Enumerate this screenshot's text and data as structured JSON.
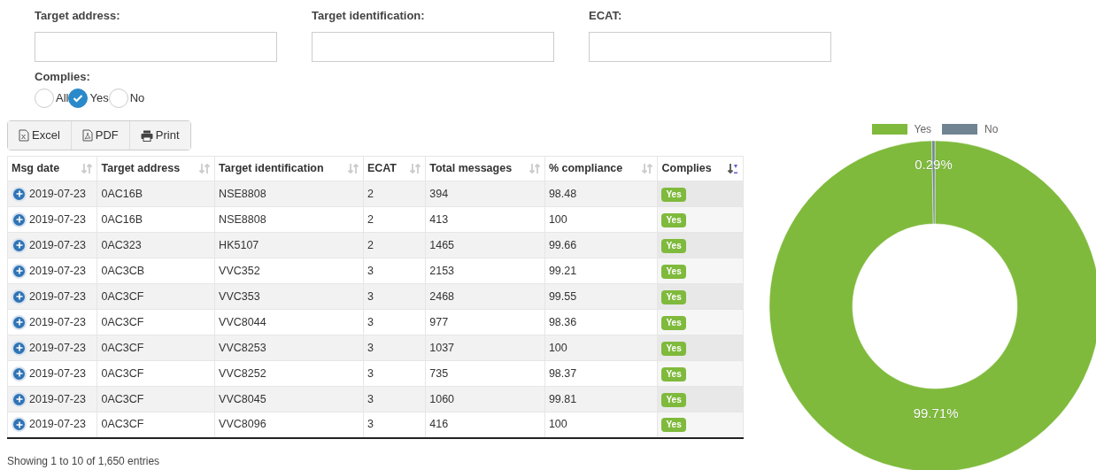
{
  "filters": [
    {
      "label": "Target address:"
    },
    {
      "label": "Target identification:"
    },
    {
      "label": "ECAT:"
    }
  ],
  "complies_filter": {
    "label": "Complies:",
    "options": [
      {
        "label": "All",
        "selected": false
      },
      {
        "label": "Yes",
        "selected": true
      },
      {
        "label": "No",
        "selected": false
      }
    ]
  },
  "export_buttons": [
    {
      "label": "Excel",
      "kind": "excel"
    },
    {
      "label": "PDF",
      "kind": "pdf"
    },
    {
      "label": "Print",
      "kind": "print"
    }
  ],
  "table": {
    "columns": [
      {
        "label": "Msg date",
        "sorted": false
      },
      {
        "label": "Target address",
        "sorted": false
      },
      {
        "label": "Target identification",
        "sorted": false
      },
      {
        "label": "ECAT",
        "sorted": false
      },
      {
        "label": "Total messages",
        "sorted": false
      },
      {
        "label": "% compliance",
        "sorted": false
      },
      {
        "label": "Complies",
        "sorted": true
      }
    ],
    "rows": [
      [
        "2019-07-23",
        "0AC16B",
        "NSE8808",
        "2",
        "394",
        "98.48",
        "Yes"
      ],
      [
        "2019-07-23",
        "0AC16B",
        "NSE8808",
        "2",
        "413",
        "100",
        "Yes"
      ],
      [
        "2019-07-23",
        "0AC323",
        "HK5107",
        "2",
        "1465",
        "99.66",
        "Yes"
      ],
      [
        "2019-07-23",
        "0AC3CB",
        "VVC352",
        "3",
        "2153",
        "99.21",
        "Yes"
      ],
      [
        "2019-07-23",
        "0AC3CF",
        "VVC353",
        "3",
        "2468",
        "99.55",
        "Yes"
      ],
      [
        "2019-07-23",
        "0AC3CF",
        "VVC8044",
        "3",
        "977",
        "98.36",
        "Yes"
      ],
      [
        "2019-07-23",
        "0AC3CF",
        "VVC8253",
        "3",
        "1037",
        "100",
        "Yes"
      ],
      [
        "2019-07-23",
        "0AC3CF",
        "VVC8252",
        "3",
        "735",
        "98.37",
        "Yes"
      ],
      [
        "2019-07-23",
        "0AC3CF",
        "VVC8045",
        "3",
        "1060",
        "99.81",
        "Yes"
      ],
      [
        "2019-07-23",
        "0AC3CF",
        "VVC8096",
        "3",
        "416",
        "100",
        "Yes"
      ]
    ]
  },
  "info": "Showing 1 to 10 of 1,650 entries",
  "chart": {
    "chart_data": {
      "type": "donut",
      "legend": "top",
      "categories": [
        "Yes",
        "No"
      ],
      "values": [
        99.71,
        0.29
      ],
      "colors": [
        "#7fba3c",
        "#708491"
      ],
      "value_labels": [
        "99.71%",
        "0.29%"
      ]
    }
  }
}
